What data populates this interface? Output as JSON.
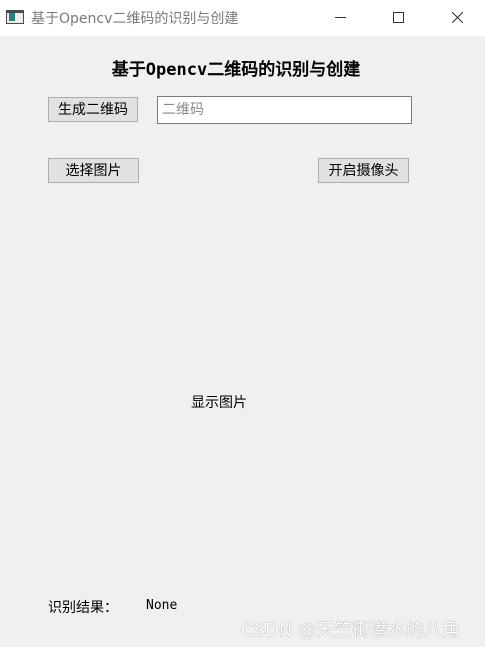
{
  "window": {
    "title": "基于Opencv二维码的识别与创建",
    "icon": "app-window-icon",
    "controls": {
      "minimize_icon": "minimize-icon",
      "maximize_icon": "maximize-icon",
      "close_icon": "close-icon"
    }
  },
  "main": {
    "heading": "基于Opencv二维码的识别与创建",
    "generate_button": "生成二维码",
    "qr_input": {
      "value": "",
      "placeholder": "二维码"
    },
    "select_image_button": "选择图片",
    "open_camera_button": "开启摄像头",
    "image_display_label": "显示图片",
    "result_label": "识别结果：",
    "result_value": "None"
  },
  "watermark": "CSDN @天竺街潜水的八角",
  "colors": {
    "window_bg": "#f0f0f0",
    "titlebar_bg": "#ffffff",
    "button_bg": "#e1e1e1",
    "button_border": "#adadad",
    "input_border": "#7a7a7a",
    "title_text": "#7a7a7a"
  }
}
